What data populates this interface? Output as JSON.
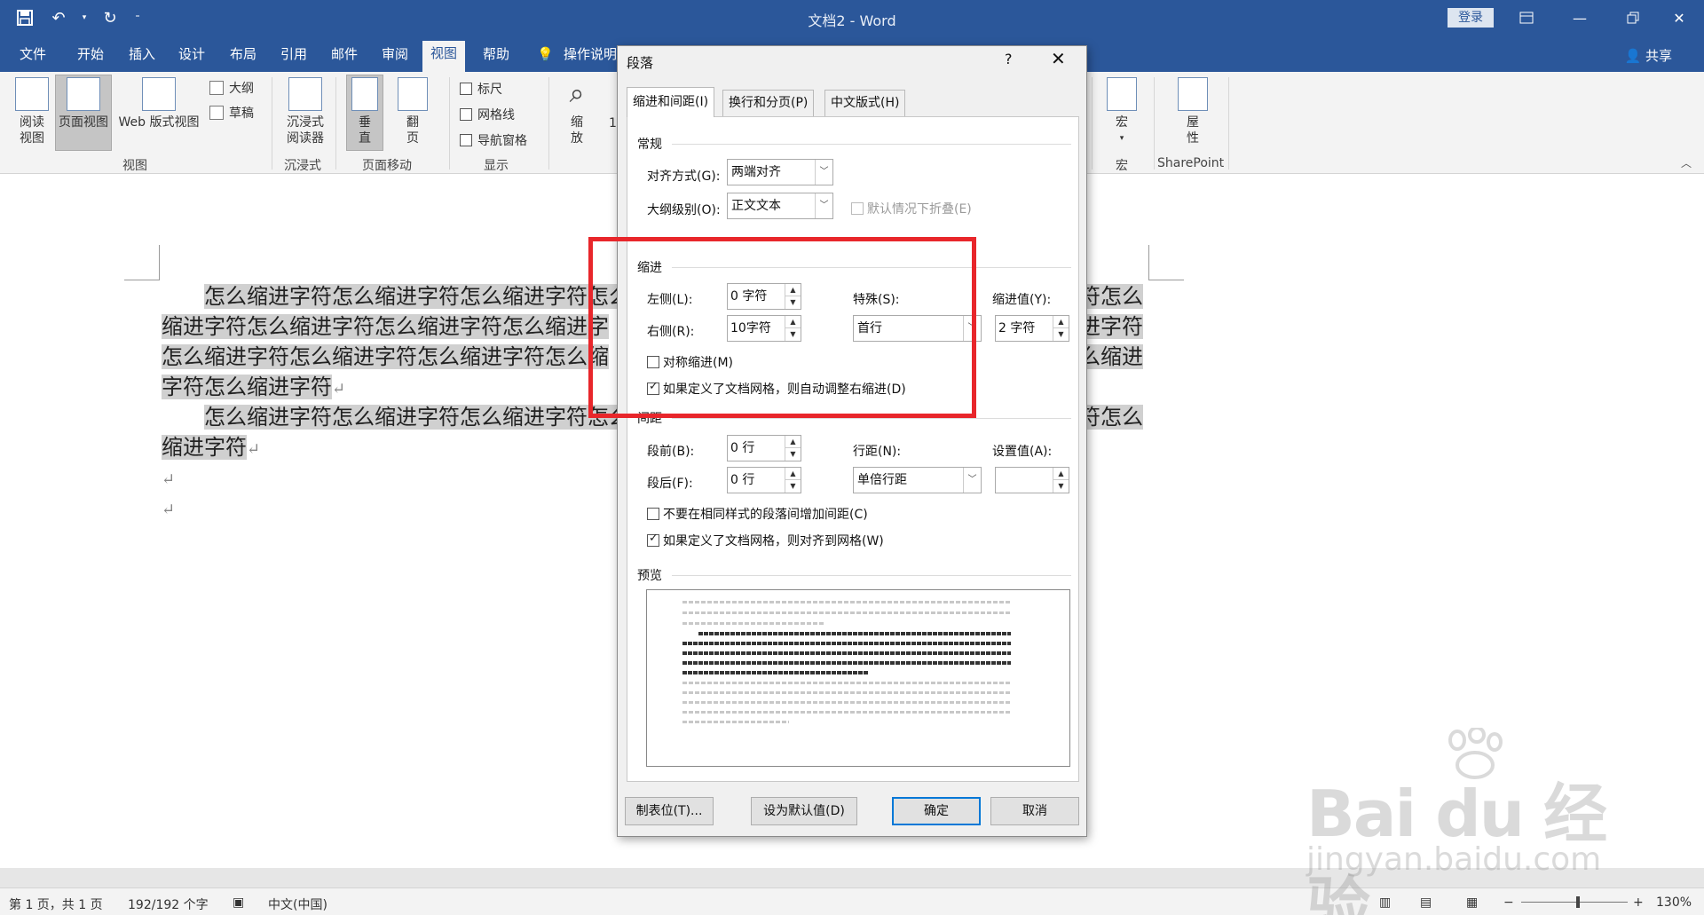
{
  "app": {
    "title": "文档2  -  Word",
    "login": "登录",
    "share": "共享"
  },
  "menu": {
    "tabs": [
      "文件",
      "开始",
      "插入",
      "设计",
      "布局",
      "引用",
      "邮件",
      "审阅",
      "视图",
      "帮助"
    ],
    "tell_me": "操作说明"
  },
  "ribbon": {
    "read_mode": [
      "阅读",
      "视图"
    ],
    "print_layout": "页面视图",
    "web_layout": "Web 版式视图",
    "outline": "大纲",
    "draft": "草稿",
    "group_views": "视图",
    "immersive_reader": [
      "沉浸式",
      "阅读器"
    ],
    "group_immersive": "沉浸式",
    "vertical": [
      "垂",
      "直"
    ],
    "side_to_side": [
      "翻",
      "页"
    ],
    "group_page_movement": "页面移动",
    "ruler": "标尺",
    "gridlines": "网格线",
    "nav_pane": "导航窗格",
    "group_show": "显示",
    "zoom": [
      "缩",
      "放"
    ],
    "zoom_partial": "1",
    "macros": "宏",
    "group_macros": "宏",
    "properties": [
      "屋",
      "性"
    ],
    "group_sharepoint": "SharePoint"
  },
  "document": {
    "lines": [
      "怎么缩进字符怎么缩进字符怎么缩进字符怎么",
      "缩进字符怎么缩进字符怎么缩进字符怎么缩进字",
      "怎么缩进字符怎么缩进字符怎么缩进字符怎么缩",
      "字符怎么缩进字符",
      "怎么缩进字符怎么缩进字符怎么缩进字符怎么",
      "缩进字符"
    ],
    "right_lines": [
      "符怎么",
      "进字符",
      "么缩进",
      "符怎么"
    ]
  },
  "status": {
    "page": "第 1 页，共 1 页",
    "words": "192/192 个字",
    "lang": "中文(中国)",
    "zoom": "130%"
  },
  "dialog": {
    "title": "段落",
    "help": "?",
    "tabs": [
      "缩进和间距(I)",
      "换行和分页(P)",
      "中文版式(H)"
    ],
    "general": {
      "title": "常规",
      "alignment_label": "对齐方式(G):",
      "alignment_value": "两端对齐",
      "outline_label": "大纲级别(O):",
      "outline_value": "正文文本",
      "collapsed_label": "默认情况下折叠(E)"
    },
    "indent": {
      "title": "缩进",
      "left_label": "左侧(L):",
      "left_value": "0 字符",
      "right_label": "右侧(R):",
      "right_value": "10字符",
      "special_label": "特殊(S):",
      "special_value": "首行",
      "by_label": "缩进值(Y):",
      "by_value": "2 字符",
      "mirror_label": "对称缩进(M)",
      "auto_adjust_label": "如果定义了文档网格，则自动调整右缩进(D)"
    },
    "spacing": {
      "title": "间距",
      "before_label": "段前(B):",
      "before_value": "0 行",
      "after_label": "段后(F):",
      "after_value": "0 行",
      "line_label": "行距(N):",
      "line_value": "单倍行距",
      "at_label": "设置值(A):",
      "at_value": "",
      "no_space_label": "不要在相同样式的段落间增加间距(C)",
      "snap_grid_label": "如果定义了文档网格，则对齐到网格(W)"
    },
    "preview": {
      "title": "预览"
    },
    "buttons": {
      "tabs": "制表位(T)...",
      "set_default": "设为默认值(D)",
      "ok": "确定",
      "cancel": "取消"
    }
  },
  "watermark": {
    "main": "Bai du 经验",
    "url": "jingyan.baidu.com"
  },
  "colors": {
    "word_blue": "#2b579a",
    "highlight": "#d0d0d0",
    "annotation_red": "#e8262b"
  }
}
